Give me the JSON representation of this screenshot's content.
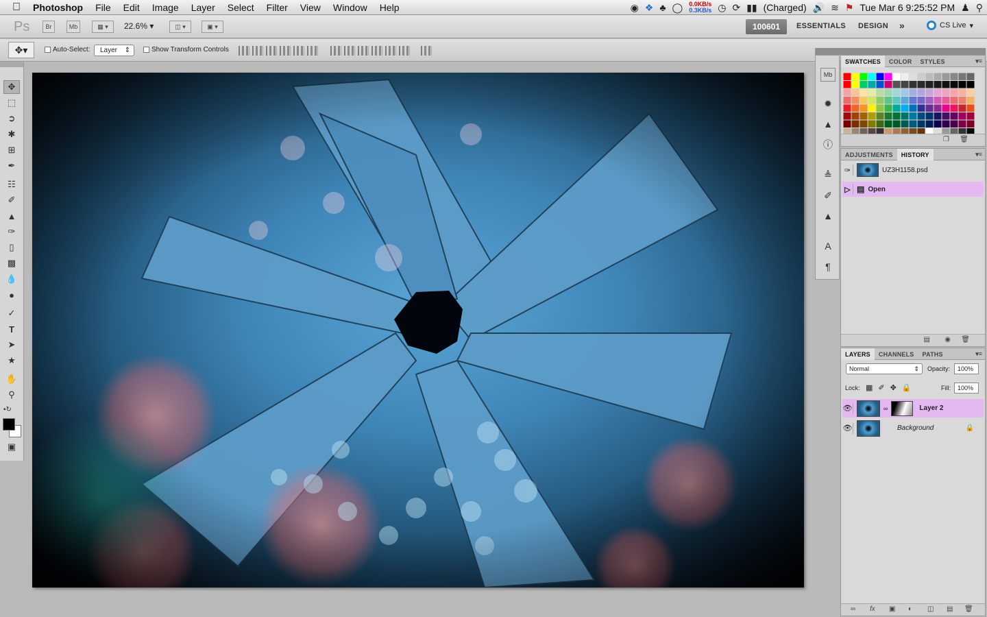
{
  "menubar": {
    "app_name": "Photoshop",
    "items": [
      "File",
      "Edit",
      "Image",
      "Layer",
      "Select",
      "Filter",
      "View",
      "Window",
      "Help"
    ],
    "net_down": "0.0KB/s",
    "net_up": "0.3KB/s",
    "battery": "(Charged)",
    "clock": "Tue Mar 6  9:25:52 PM"
  },
  "appbar": {
    "logo": "Ps",
    "bridge": "Br",
    "minibridge": "Mb",
    "zoom": "22.6%",
    "workspace_badge": "100601",
    "essentials": "ESSENTIALS",
    "design": "DESIGN",
    "more": "»",
    "cs_live": "CS Live"
  },
  "options": {
    "auto_select": "Auto-Select:",
    "layer_select": "Layer",
    "show_transform": "Show Transform Controls"
  },
  "swatch_panel": {
    "tabs": [
      "SWATCHES",
      "COLOR",
      "STYLES"
    ],
    "rows": [
      [
        "#ff0000",
        "#ffff00",
        "#00ff00",
        "#00ffff",
        "#0000ff",
        "#ff00ff",
        "#ffffff",
        "#eeeeee",
        "#dddddd",
        "#cccccc",
        "#bbbbbb",
        "#aaaaaa",
        "#999999",
        "#888888",
        "#777777",
        "#666666"
      ],
      [
        "#ff0000",
        "#ffff00",
        "#00cc66",
        "#00aaaa",
        "#0055cc",
        "#cc0077",
        "#555555",
        "#444444",
        "#333333",
        "#2a2a2a",
        "#222222",
        "#1a1a1a",
        "#111111",
        "#0b0b0b",
        "#050505",
        "#000000"
      ],
      [
        "#f5a3a0",
        "#f8c39b",
        "#fbe5a0",
        "#e0f0a0",
        "#b6dca0",
        "#9fd7b0",
        "#9fd9d6",
        "#a0c8e6",
        "#a4aee0",
        "#b0a4dc",
        "#c9a4d8",
        "#e6a4d2",
        "#f0a4bc",
        "#f6a4a8",
        "#f4b0a0",
        "#f8d0a0"
      ],
      [
        "#f26a65",
        "#f58f5c",
        "#f7c95a",
        "#d4e65e",
        "#8fcc66",
        "#5cc489",
        "#5ac7c1",
        "#5aa8db",
        "#6079cf",
        "#7a67c7",
        "#a461c2",
        "#d65ab8",
        "#ea5c95",
        "#ef6a74",
        "#ee8266",
        "#f4b066"
      ],
      [
        "#ed1c24",
        "#f26522",
        "#f7941d",
        "#fff200",
        "#8dc63f",
        "#39b54a",
        "#00a99d",
        "#00aeef",
        "#0072bc",
        "#2e3192",
        "#662d91",
        "#92278f",
        "#ec008c",
        "#ed145b",
        "#c1272d",
        "#e94e1b"
      ],
      [
        "#9e0b0f",
        "#a0410d",
        "#a36209",
        "#aba000",
        "#598527",
        "#197b30",
        "#007236",
        "#00746b",
        "#0076a3",
        "#004a80",
        "#003471",
        "#1b1464",
        "#440e62",
        "#630460",
        "#9e005d",
        "#9e0039"
      ],
      [
        "#790000",
        "#7b2e00",
        "#7d4900",
        "#827b00",
        "#406618",
        "#005e20",
        "#005826",
        "#005952",
        "#005b7f",
        "#003663",
        "#002157",
        "#0d004c",
        "#32004b",
        "#4b0049",
        "#7b0046",
        "#7a0026"
      ],
      [
        "#c7b299",
        "#998675",
        "#736357",
        "#534741",
        "#362f2d",
        "#c69c6d",
        "#a67c52",
        "#8c6239",
        "#754c24",
        "#603913",
        "#ffffff",
        "#dddddd",
        "#999999",
        "#666666",
        "#333333",
        "#000000"
      ]
    ]
  },
  "history_panel": {
    "tabs": [
      "ADJUSTMENTS",
      "HISTORY"
    ],
    "snapshot": "UZ3H1158.psd",
    "step": "Open"
  },
  "layers_panel": {
    "tabs": [
      "LAYERS",
      "CHANNELS",
      "PATHS"
    ],
    "blend_mode": "Normal",
    "opacity_label": "Opacity:",
    "opacity": "100%",
    "lock_label": "Lock:",
    "fill_label": "Fill:",
    "fill": "100%",
    "layers": [
      {
        "name": "Layer 2"
      },
      {
        "name": "Background"
      }
    ]
  },
  "icons": {
    "apple": "apple-icon",
    "search": "search-icon",
    "user": "user-icon"
  }
}
